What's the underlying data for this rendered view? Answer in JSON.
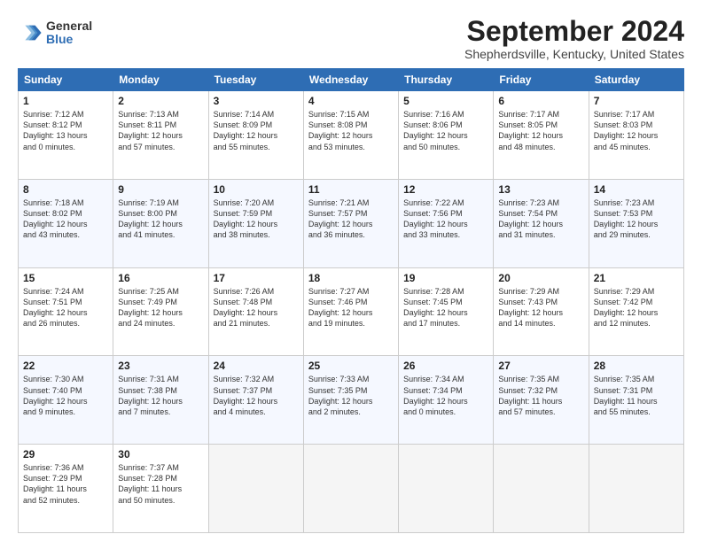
{
  "logo": {
    "general": "General",
    "blue": "Blue"
  },
  "title": "September 2024",
  "location": "Shepherdsville, Kentucky, United States",
  "days_of_week": [
    "Sunday",
    "Monday",
    "Tuesday",
    "Wednesday",
    "Thursday",
    "Friday",
    "Saturday"
  ],
  "weeks": [
    [
      {
        "day": "1",
        "info": "Sunrise: 7:12 AM\nSunset: 8:12 PM\nDaylight: 13 hours\nand 0 minutes."
      },
      {
        "day": "2",
        "info": "Sunrise: 7:13 AM\nSunset: 8:11 PM\nDaylight: 12 hours\nand 57 minutes."
      },
      {
        "day": "3",
        "info": "Sunrise: 7:14 AM\nSunset: 8:09 PM\nDaylight: 12 hours\nand 55 minutes."
      },
      {
        "day": "4",
        "info": "Sunrise: 7:15 AM\nSunset: 8:08 PM\nDaylight: 12 hours\nand 53 minutes."
      },
      {
        "day": "5",
        "info": "Sunrise: 7:16 AM\nSunset: 8:06 PM\nDaylight: 12 hours\nand 50 minutes."
      },
      {
        "day": "6",
        "info": "Sunrise: 7:17 AM\nSunset: 8:05 PM\nDaylight: 12 hours\nand 48 minutes."
      },
      {
        "day": "7",
        "info": "Sunrise: 7:17 AM\nSunset: 8:03 PM\nDaylight: 12 hours\nand 45 minutes."
      }
    ],
    [
      {
        "day": "8",
        "info": "Sunrise: 7:18 AM\nSunset: 8:02 PM\nDaylight: 12 hours\nand 43 minutes."
      },
      {
        "day": "9",
        "info": "Sunrise: 7:19 AM\nSunset: 8:00 PM\nDaylight: 12 hours\nand 41 minutes."
      },
      {
        "day": "10",
        "info": "Sunrise: 7:20 AM\nSunset: 7:59 PM\nDaylight: 12 hours\nand 38 minutes."
      },
      {
        "day": "11",
        "info": "Sunrise: 7:21 AM\nSunset: 7:57 PM\nDaylight: 12 hours\nand 36 minutes."
      },
      {
        "day": "12",
        "info": "Sunrise: 7:22 AM\nSunset: 7:56 PM\nDaylight: 12 hours\nand 33 minutes."
      },
      {
        "day": "13",
        "info": "Sunrise: 7:23 AM\nSunset: 7:54 PM\nDaylight: 12 hours\nand 31 minutes."
      },
      {
        "day": "14",
        "info": "Sunrise: 7:23 AM\nSunset: 7:53 PM\nDaylight: 12 hours\nand 29 minutes."
      }
    ],
    [
      {
        "day": "15",
        "info": "Sunrise: 7:24 AM\nSunset: 7:51 PM\nDaylight: 12 hours\nand 26 minutes."
      },
      {
        "day": "16",
        "info": "Sunrise: 7:25 AM\nSunset: 7:49 PM\nDaylight: 12 hours\nand 24 minutes."
      },
      {
        "day": "17",
        "info": "Sunrise: 7:26 AM\nSunset: 7:48 PM\nDaylight: 12 hours\nand 21 minutes."
      },
      {
        "day": "18",
        "info": "Sunrise: 7:27 AM\nSunset: 7:46 PM\nDaylight: 12 hours\nand 19 minutes."
      },
      {
        "day": "19",
        "info": "Sunrise: 7:28 AM\nSunset: 7:45 PM\nDaylight: 12 hours\nand 17 minutes."
      },
      {
        "day": "20",
        "info": "Sunrise: 7:29 AM\nSunset: 7:43 PM\nDaylight: 12 hours\nand 14 minutes."
      },
      {
        "day": "21",
        "info": "Sunrise: 7:29 AM\nSunset: 7:42 PM\nDaylight: 12 hours\nand 12 minutes."
      }
    ],
    [
      {
        "day": "22",
        "info": "Sunrise: 7:30 AM\nSunset: 7:40 PM\nDaylight: 12 hours\nand 9 minutes."
      },
      {
        "day": "23",
        "info": "Sunrise: 7:31 AM\nSunset: 7:38 PM\nDaylight: 12 hours\nand 7 minutes."
      },
      {
        "day": "24",
        "info": "Sunrise: 7:32 AM\nSunset: 7:37 PM\nDaylight: 12 hours\nand 4 minutes."
      },
      {
        "day": "25",
        "info": "Sunrise: 7:33 AM\nSunset: 7:35 PM\nDaylight: 12 hours\nand 2 minutes."
      },
      {
        "day": "26",
        "info": "Sunrise: 7:34 AM\nSunset: 7:34 PM\nDaylight: 12 hours\nand 0 minutes."
      },
      {
        "day": "27",
        "info": "Sunrise: 7:35 AM\nSunset: 7:32 PM\nDaylight: 11 hours\nand 57 minutes."
      },
      {
        "day": "28",
        "info": "Sunrise: 7:35 AM\nSunset: 7:31 PM\nDaylight: 11 hours\nand 55 minutes."
      }
    ],
    [
      {
        "day": "29",
        "info": "Sunrise: 7:36 AM\nSunset: 7:29 PM\nDaylight: 11 hours\nand 52 minutes."
      },
      {
        "day": "30",
        "info": "Sunrise: 7:37 AM\nSunset: 7:28 PM\nDaylight: 11 hours\nand 50 minutes."
      },
      {
        "day": "",
        "info": ""
      },
      {
        "day": "",
        "info": ""
      },
      {
        "day": "",
        "info": ""
      },
      {
        "day": "",
        "info": ""
      },
      {
        "day": "",
        "info": ""
      }
    ]
  ]
}
